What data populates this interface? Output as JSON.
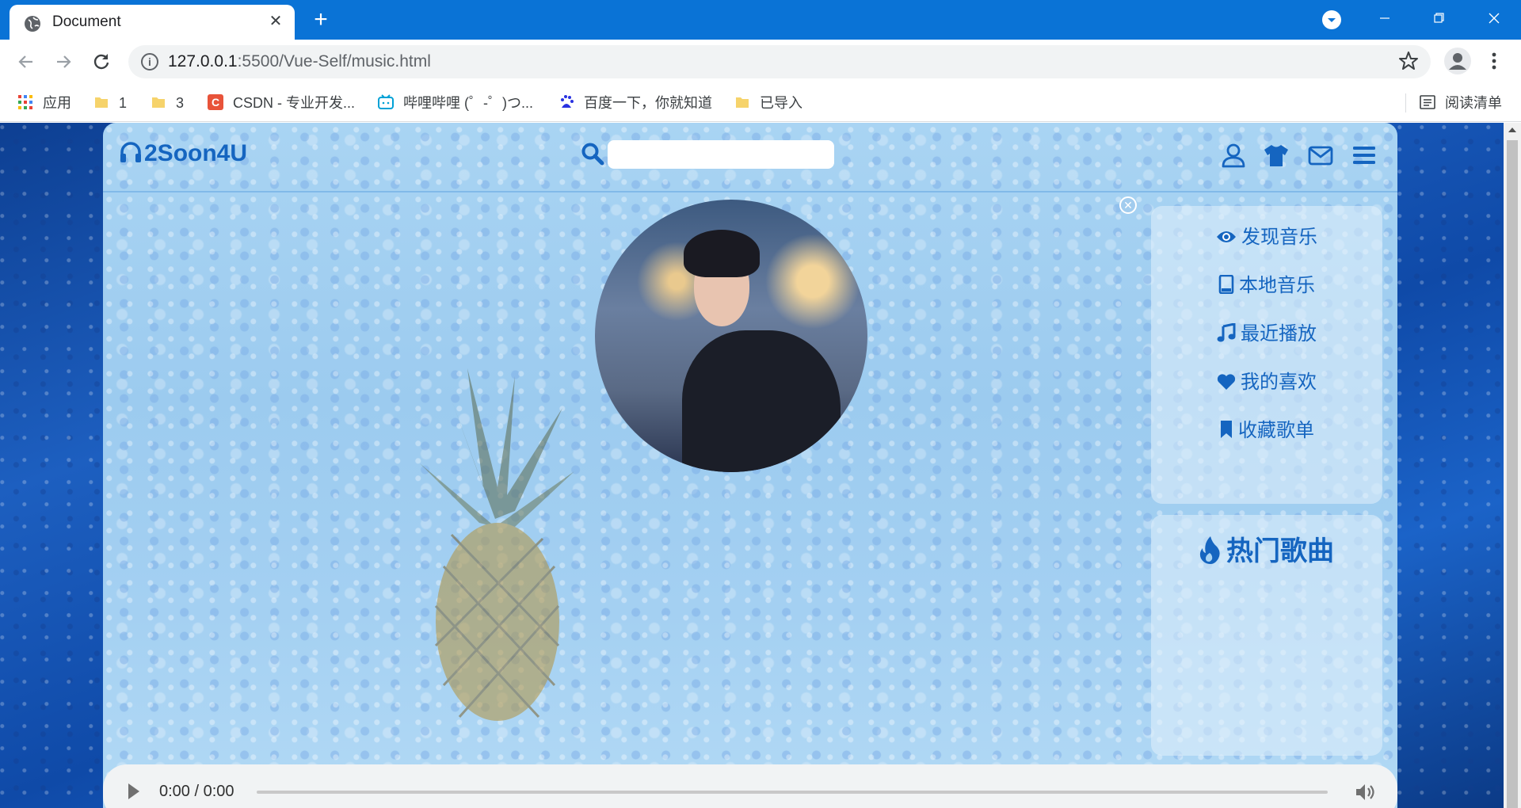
{
  "browser": {
    "tab_title": "Document",
    "tab_close": "✕",
    "new_tab": "+",
    "url_host": "127.0.0.1",
    "url_rest": ":5500/Vue-Self/music.html",
    "bookmarks": [
      {
        "label": "应用",
        "icon": "apps-grid-icon"
      },
      {
        "label": "1",
        "icon": "folder-icon"
      },
      {
        "label": "3",
        "icon": "folder-icon"
      },
      {
        "label": "CSDN - 专业开发...",
        "icon": "csdn-icon"
      },
      {
        "label": "哔哩哔哩 (゜-゜)つ...",
        "icon": "bilibili-icon"
      },
      {
        "label": "百度一下，你就知道",
        "icon": "baidu-icon"
      },
      {
        "label": "已导入",
        "icon": "folder-icon"
      }
    ],
    "reading_list": "阅读清单",
    "colors": {
      "tabbar": "#0a73d6",
      "folder": "#f6d36b"
    }
  },
  "app": {
    "logo": "2Soon4U",
    "search_value": "",
    "menu": [
      {
        "label": "发现音乐",
        "icon": "eye-icon"
      },
      {
        "label": "本地音乐",
        "icon": "tablet-icon"
      },
      {
        "label": "最近播放",
        "icon": "music-note-icon"
      },
      {
        "label": "我的喜欢",
        "icon": "heart-icon"
      },
      {
        "label": "收藏歌单",
        "icon": "bookmark-icon"
      }
    ],
    "hot_title": "热门歌曲",
    "close_glyph": "✕",
    "colors": {
      "accent": "#1565c0"
    }
  },
  "player": {
    "time": "0:00 / 0:00",
    "progress": 0
  }
}
